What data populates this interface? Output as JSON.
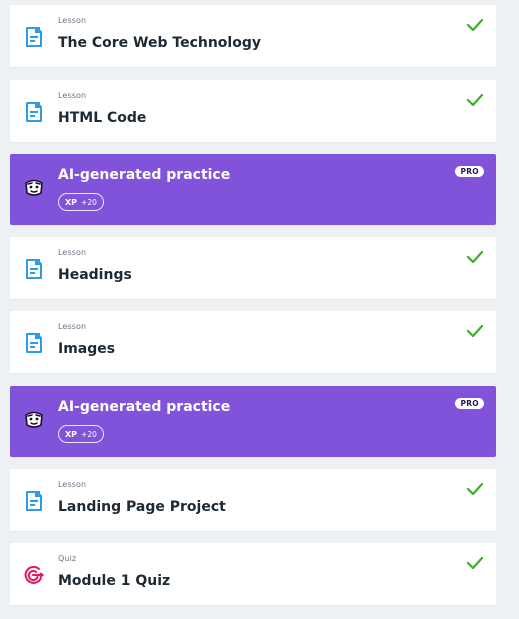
{
  "colors": {
    "background": "#eef1f4",
    "card": "#ffffff",
    "practice": "#8153db",
    "check": "#3fae29",
    "lesson_icon": "#2e9be6",
    "quiz_icon": "#e8175d"
  },
  "items": [
    {
      "kind": "Lesson",
      "title": "The Core Web Technology",
      "status_icon": "check-icon",
      "icon": "document-icon"
    },
    {
      "kind": "Lesson",
      "title": "HTML Code",
      "status_icon": "check-icon",
      "icon": "document-icon"
    },
    {
      "title": "AI-generated practice",
      "badge": "PRO",
      "xp_label": "XP",
      "xp_value": "+20",
      "icon": "ai-face-icon"
    },
    {
      "kind": "Lesson",
      "title": "Headings",
      "status_icon": "check-icon",
      "icon": "document-icon"
    },
    {
      "kind": "Lesson",
      "title": "Images",
      "status_icon": "check-icon",
      "icon": "document-icon"
    },
    {
      "title": "AI-generated practice",
      "badge": "PRO",
      "xp_label": "XP",
      "xp_value": "+20",
      "icon": "ai-face-icon"
    },
    {
      "kind": "Lesson",
      "title": "Landing Page Project",
      "status_icon": "check-icon",
      "icon": "document-icon"
    },
    {
      "kind": "Quiz",
      "title": "Module 1 Quiz",
      "status_icon": "check-icon",
      "icon": "target-icon"
    }
  ]
}
